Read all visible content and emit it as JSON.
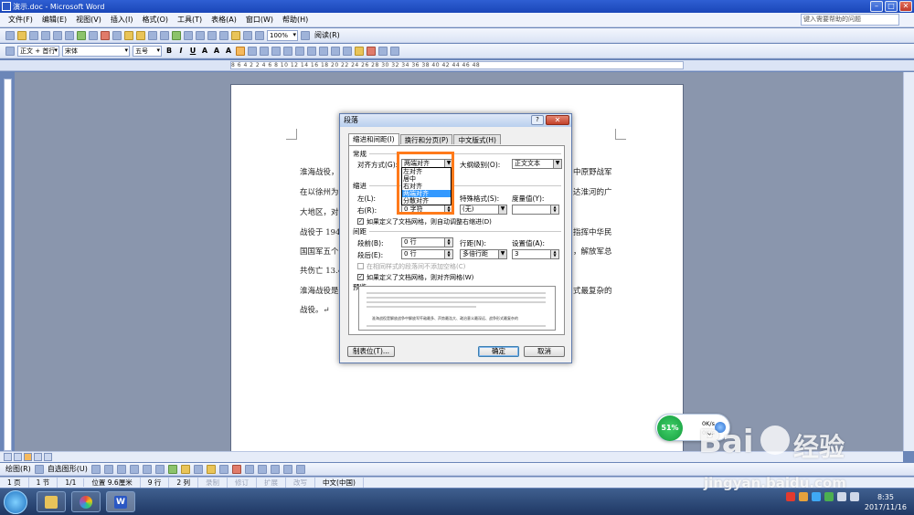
{
  "window": {
    "title": "演示.doc - Microsoft Word",
    "help_placeholder": "键入需要帮助的问题"
  },
  "menu": [
    "文件(F)",
    "编辑(E)",
    "视图(V)",
    "插入(I)",
    "格式(O)",
    "工具(T)",
    "表格(A)",
    "窗口(W)",
    "帮助(H)"
  ],
  "toolbar": {
    "zoom": "100%",
    "read_label": "阅读(R)",
    "style": "正文 + 首行",
    "font": "宋体",
    "size": "五号"
  },
  "ruler": {
    "marks": "8  6  4  2     2  4  6  8  10  12  14  16  18  20  22  24  26  28  30  32  34  36  38  40  42  44  46  48"
  },
  "document": {
    "lines": [
      "淮海战役，",
      "在以徐州为",
      "大地区，对",
      "战役于 194",
      "国国军五个",
      "共伤亡 13.4",
      "淮海战役是"
    ],
    "right_fragments": [
      "中原野战军",
      "达淮河的广",
      "指挥中华民",
      "，解放军总",
      "式最复杂的"
    ],
    "last_line": "战役。↵"
  },
  "dialog": {
    "title": "段落",
    "help": "?",
    "close": "✕",
    "tabs": [
      "缩进和间距(I)",
      "换行和分页(P)",
      "中文版式(H)"
    ],
    "general": {
      "section": "常规",
      "alignment_label": "对齐方式(G):",
      "alignment_value": "两端对齐",
      "outline_label": "大纲级别(O):",
      "outline_value": "正文文本"
    },
    "alignment_options": [
      "左对齐",
      "居中",
      "右对齐",
      "两端对齐",
      "分散对齐"
    ],
    "alignment_selected_index": 3,
    "indent": {
      "section": "缩进",
      "left_label": "左(L):",
      "right_label": "右(R):",
      "right_value": "0 字符",
      "special_label": "特殊格式(S):",
      "special_value": "(无)",
      "by_label": "度量值(Y):",
      "auto_adjust_label": "如果定义了文档网格，则自动调整右缩进(D)"
    },
    "spacing": {
      "section": "间距",
      "before_label": "段前(B):",
      "before_value": "0 行",
      "after_label": "段后(E):",
      "after_value": "0 行",
      "line_label": "行距(N):",
      "line_value": "多倍行距",
      "at_label": "设置值(A):",
      "at_value": "3",
      "no_space_label": "在相同样式的段落间不添加空格(C)",
      "snap_grid_label": "如果定义了文档网格，则对齐网格(W)"
    },
    "preview": {
      "section": "预览",
      "sample_text": "淮海战役是解放战争中解放军歼敌最多、声势最浩大、政治意义最深远、战争形式最复杂的"
    },
    "buttons": {
      "tabs": "制表位(T)...",
      "ok": "确定",
      "cancel": "取消"
    }
  },
  "drawbar": {
    "draw_label": "绘图(R)",
    "autoshapes_label": "自选图形(U)"
  },
  "status": {
    "page": "1 页",
    "section": "1 节",
    "pages": "1/1",
    "position": "位置 9.6厘米",
    "line": "9 行",
    "column": "2 列",
    "rec": "录制",
    "trk": "修订",
    "ext": "扩展",
    "ovr": "改写",
    "language": "中文(中国)"
  },
  "netmonitor": {
    "percent": "51%",
    "up": "0K/s",
    "down": "0K/s"
  },
  "watermark": {
    "brand": "Bai",
    "paw_label": "经验",
    "url": "jingyan.baidu.com"
  },
  "clock": {
    "time": "8:35",
    "date": "2017/11/16"
  },
  "colors": {
    "highlight": "#ff7a1a",
    "selection": "#3399ff",
    "titlebar": "#2f5fd3"
  }
}
